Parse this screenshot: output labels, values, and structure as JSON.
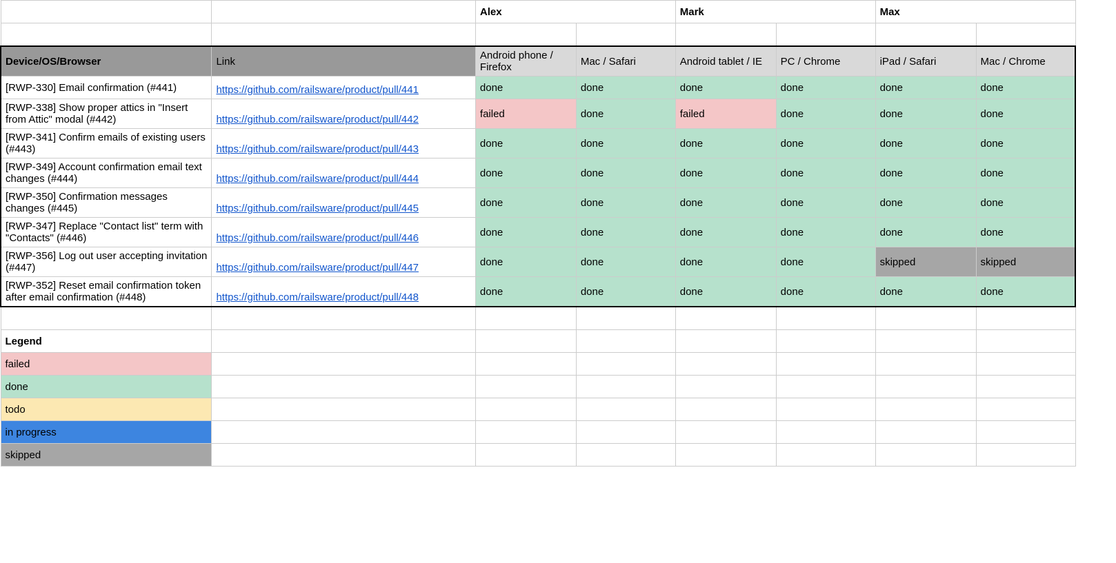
{
  "people": [
    "Alex",
    "Mark",
    "Max"
  ],
  "header": {
    "device": "Device/OS/Browser",
    "link": "Link"
  },
  "envs": [
    "Android phone / Firefox",
    "Mac / Safari",
    "Android tablet / IE",
    "PC / Chrome",
    "iPad / Safari",
    "Mac / Chrome"
  ],
  "rows": [
    {
      "title": "[RWP-330] Email confirmation (#441)",
      "link": "https://github.com/railsware/product/pull/441",
      "cells": [
        "done",
        "done",
        "done",
        "done",
        "done",
        "done"
      ]
    },
    {
      "title": "[RWP-338] Show proper attics in \"Insert from Attic\" modal (#442)",
      "link": "https://github.com/railsware/product/pull/442",
      "cells": [
        "failed",
        "done",
        "failed",
        "done",
        "done",
        "done"
      ]
    },
    {
      "title": "[RWP-341] Confirm emails of existing users (#443)",
      "link": "https://github.com/railsware/product/pull/443",
      "cells": [
        "done",
        "done",
        "done",
        "done",
        "done",
        "done"
      ]
    },
    {
      "title": "[RWP-349] Account confirmation email text changes (#444)",
      "link": "https://github.com/railsware/product/pull/444",
      "cells": [
        "done",
        "done",
        "done",
        "done",
        "done",
        "done"
      ]
    },
    {
      "title": "[RWP-350] Confirmation messages changes (#445)",
      "link": "https://github.com/railsware/product/pull/445",
      "cells": [
        "done",
        "done",
        "done",
        "done",
        "done",
        "done"
      ]
    },
    {
      "title": "[RWP-347] Replace \"Contact list\" term with \"Contacts\" (#446)",
      "link": "https://github.com/railsware/product/pull/446",
      "cells": [
        "done",
        "done",
        "done",
        "done",
        "done",
        "done"
      ]
    },
    {
      "title": "[RWP-356] Log out user accepting invitation (#447)",
      "link": "https://github.com/railsware/product/pull/447",
      "cells": [
        "done",
        "done",
        "done",
        "done",
        "skipped",
        "skipped"
      ]
    },
    {
      "title": "[RWP-352] Reset email confirmation token after email confirmation (#448)",
      "link": "https://github.com/railsware/product/pull/448",
      "cells": [
        "done",
        "done",
        "done",
        "done",
        "done",
        "done"
      ]
    }
  ],
  "legendTitle": "Legend",
  "legend": [
    {
      "label": "failed",
      "class": "status-failed"
    },
    {
      "label": "done",
      "class": "status-done"
    },
    {
      "label": "todo",
      "class": "status-todo"
    },
    {
      "label": "in progress",
      "class": "status-inprog"
    },
    {
      "label": "skipped",
      "class": "status-skipped"
    }
  ],
  "statusClass": {
    "done": "status-done",
    "failed": "status-failed",
    "todo": "status-todo",
    "in progress": "status-inprog",
    "skipped": "status-skipped"
  }
}
